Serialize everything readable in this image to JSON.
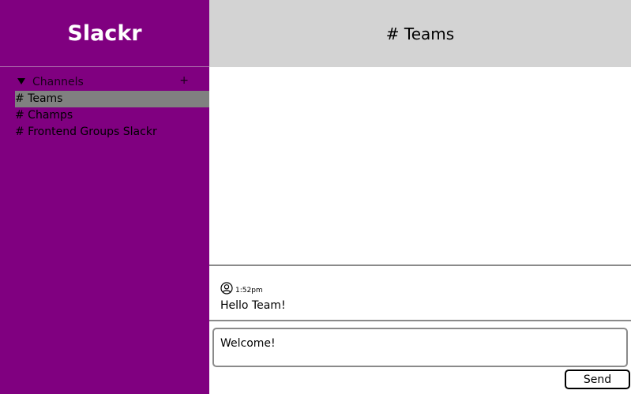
{
  "app": {
    "title": "Slackr"
  },
  "sidebar": {
    "section_label": "Channels",
    "add_label": "+",
    "channels": [
      {
        "label": "# Teams",
        "active": true
      },
      {
        "label": "# Champs",
        "active": false
      },
      {
        "label": "# Frontend Groups Slackr",
        "active": false
      }
    ]
  },
  "main": {
    "channel_title": "# Teams",
    "messages": [
      {
        "time": "1:52pm",
        "text": "Hello Team!",
        "avatar_icon": "user-circle-icon"
      }
    ],
    "composer": {
      "value": "Welcome!"
    },
    "send_label": "Send"
  },
  "colors": {
    "sidebar_bg": "#800080",
    "topbar_bg": "#d3d3d3",
    "active_channel_bg": "#808080"
  }
}
